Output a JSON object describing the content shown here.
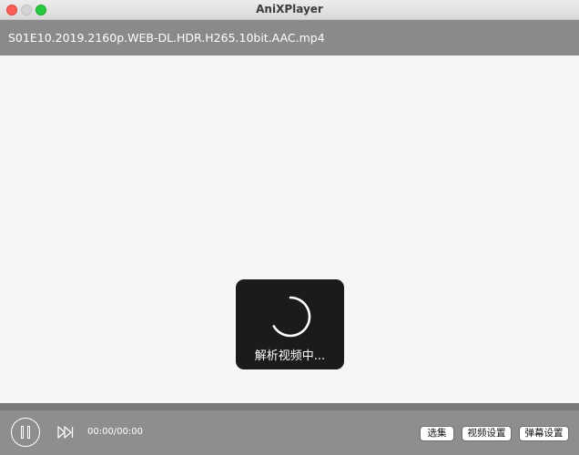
{
  "window": {
    "title": "AniXPlayer"
  },
  "header": {
    "file_name": "S01E10.2019.2160p.WEB-DL.HDR.H265.10bit.AAC.mp4"
  },
  "player": {
    "loading_text": "解析视频中...",
    "progress_fraction": 0
  },
  "controls": {
    "play_pause_icon": "pause-icon",
    "next_icon": "skip-forward-icon",
    "time": "00:00/00:00",
    "episodes_label": "选集",
    "video_settings_label": "视频设置",
    "danmaku_settings_label": "弹幕设置"
  },
  "colors": {
    "close": "#fe5f57",
    "minimize_inactive": "#d4d4d4",
    "maximize": "#28c840",
    "header_bg": "#8a8a8a",
    "controls_bg": "#8e8e8e",
    "loading_bg": "#1b1b1b"
  }
}
